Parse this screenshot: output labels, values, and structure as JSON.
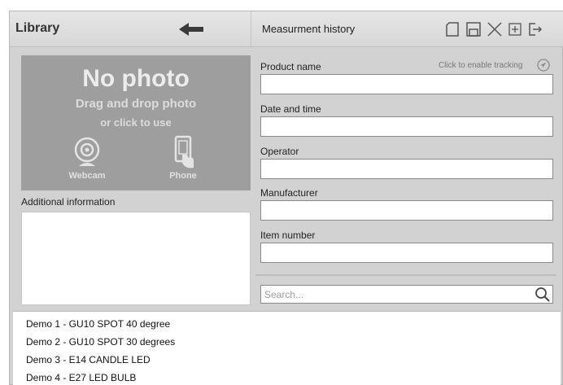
{
  "library": {
    "title": "Library",
    "back_icon": "arrow-left-icon"
  },
  "history": {
    "title": "Measurment history",
    "toolbar": [
      "new-document-icon",
      "save-icon",
      "delete-icon",
      "add-icon",
      "export-icon"
    ]
  },
  "photo": {
    "heading": "No photo",
    "drag_text": "Drag and drop photo",
    "click_text": "or click to use",
    "webcam_label": "Webcam",
    "phone_label": "Phone"
  },
  "additional": {
    "label": "Additional information",
    "value": ""
  },
  "tracking": {
    "label": "Click to enable tracking"
  },
  "form": {
    "product_name": {
      "label": "Product name",
      "value": ""
    },
    "date_time": {
      "label": "Date and time",
      "value": ""
    },
    "operator": {
      "label": "Operator",
      "value": ""
    },
    "manufacturer": {
      "label": "Manufacturer",
      "value": ""
    },
    "item_number": {
      "label": "Item number",
      "value": ""
    }
  },
  "search": {
    "placeholder": "Search..."
  },
  "list": {
    "items": [
      "Demo 1 - GU10 SPOT 40 degree",
      "Demo 2 - GU10 SPOT 30 degrees",
      "Demo 3 - E14 CANDLE LED",
      "Demo 4 - E27 LED BULB"
    ]
  },
  "colors": {
    "frame": "#d2d2d2",
    "photo_bg": "#9e9e9e",
    "header_bg": "#dedede"
  }
}
